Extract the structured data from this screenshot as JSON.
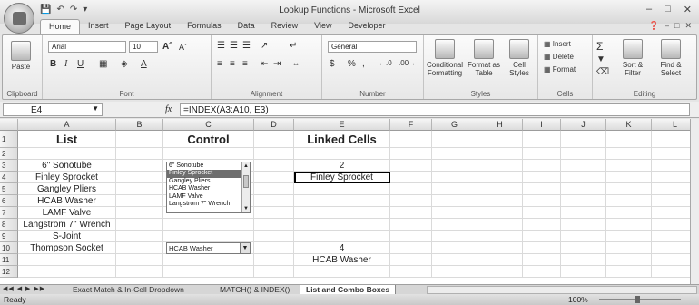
{
  "window": {
    "title": "Lookup Functions - Microsoft Excel"
  },
  "ribbon_tabs": [
    "Home",
    "Insert",
    "Page Layout",
    "Formulas",
    "Data",
    "Review",
    "View",
    "Developer"
  ],
  "ribbon": {
    "clipboard": {
      "label": "Clipboard",
      "paste": "Paste"
    },
    "font": {
      "label": "Font",
      "name": "Arial",
      "size": "10"
    },
    "alignment": {
      "label": "Alignment"
    },
    "number": {
      "label": "Number",
      "format": "General"
    },
    "styles": {
      "label": "Styles",
      "conditional": "Conditional Formatting",
      "format_table": "Format as Table",
      "cell_styles": "Cell Styles"
    },
    "cells": {
      "label": "Cells",
      "insert": "Insert",
      "delete": "Delete",
      "format": "Format"
    },
    "editing": {
      "label": "Editing",
      "sort": "Sort & Filter",
      "find": "Find & Select"
    }
  },
  "formula_bar": {
    "name_box": "E4",
    "formula": "=INDEX(A3:A10, E3)"
  },
  "columns": [
    "A",
    "B",
    "C",
    "D",
    "E",
    "F",
    "G",
    "H",
    "I",
    "J",
    "K",
    "L"
  ],
  "rows": [
    "1",
    "2",
    "3",
    "4",
    "5",
    "6",
    "7",
    "8",
    "9",
    "10",
    "11",
    "12"
  ],
  "cells": {
    "A1": "List",
    "C1": "Control",
    "E1": "Linked Cells",
    "A3": "6\" Sonotube",
    "A4": "Finley Sprocket",
    "A5": "Gangley Pliers",
    "A6": "HCAB Washer",
    "A7": "LAMF Valve",
    "A8": "Langstrom 7\" Wrench",
    "A9": "S-Joint",
    "A10": "Thompson Socket",
    "E3": "2",
    "E4": "Finley Sprocket",
    "E10": "4",
    "E11": "HCAB Washer"
  },
  "listbox": {
    "items": [
      "6\" Sonotube",
      "Finley Sprocket",
      "Gangley Pliers",
      "HCAB Washer",
      "LAMF Valve",
      "Langstrom 7\" Wrench"
    ],
    "selected_index": 1
  },
  "combobox": {
    "value": "HCAB Washer"
  },
  "sheet_tabs": [
    "Exact Match & In-Cell Dropdown",
    "MATCH() & INDEX()",
    "List and Combo Boxes"
  ],
  "active_sheet": "List and Combo Boxes",
  "status": {
    "text": "Ready",
    "zoom": "100%"
  }
}
